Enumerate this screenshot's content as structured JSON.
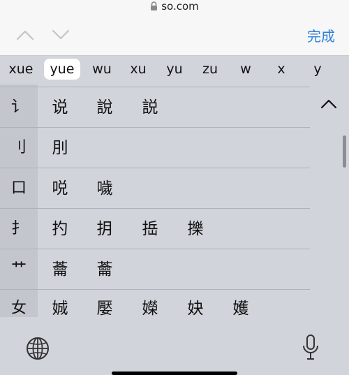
{
  "browser": {
    "url": "so.com"
  },
  "accessory": {
    "done_label": "完成"
  },
  "pinyin_options": [
    "xue",
    "yue",
    "wu",
    "xu",
    "yu",
    "zu",
    "w",
    "x",
    "y"
  ],
  "selected_pinyin": "yue",
  "candidate_rows": [
    {
      "radical": "讠",
      "chars": [
        "说",
        "說",
        "説"
      ]
    },
    {
      "radical": "刂",
      "chars": [
        "刖"
      ]
    },
    {
      "radical": "口",
      "chars": [
        "哾",
        "噦"
      ]
    },
    {
      "radical": "扌",
      "chars": [
        "扚",
        "抈",
        "捳",
        "擽"
      ]
    },
    {
      "radical": "艹",
      "chars": [
        "蘥",
        "蘥"
      ]
    },
    {
      "radical": "女",
      "chars": [
        "娍",
        "嬮",
        "嬫",
        "妜",
        "嬳"
      ]
    }
  ],
  "colors": {
    "keyboard_bg": "#d1d4db",
    "radical_column_bg": "#c3c6cd",
    "accent": "#2f80d8"
  }
}
